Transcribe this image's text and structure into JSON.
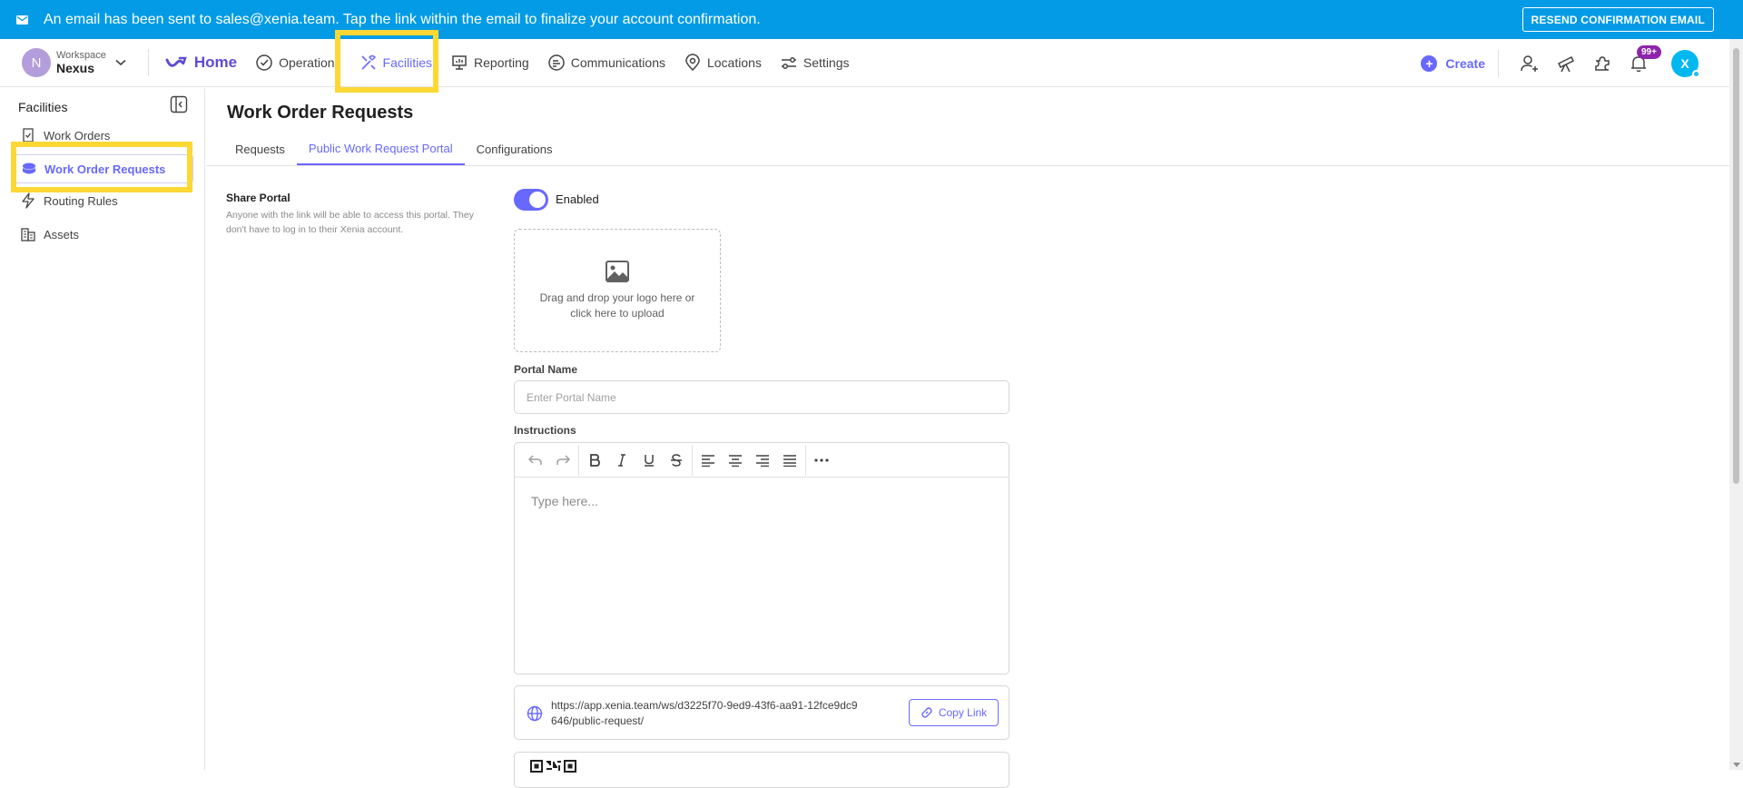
{
  "banner": {
    "message": "An email has been sent to sales@xenia.team. Tap the link within the email to finalize your account confirmation.",
    "resend_label": "RESEND CONFIRMATION EMAIL"
  },
  "workspace": {
    "initial": "N",
    "label": "Workspace",
    "name": "Nexus"
  },
  "nav": {
    "home": "Home",
    "operations": "Operations",
    "facilities": "Facilities",
    "reporting": "Reporting",
    "communications": "Communications",
    "locations": "Locations",
    "settings": "Settings"
  },
  "header_right": {
    "create_label": "Create",
    "notification_badge": "99+",
    "user_initial": "X"
  },
  "sidebar": {
    "title": "Facilities",
    "items": [
      {
        "label": "Work Orders"
      },
      {
        "label": "Work Order Requests"
      },
      {
        "label": "Routing Rules"
      },
      {
        "label": "Assets"
      }
    ]
  },
  "main": {
    "title": "Work Order Requests",
    "tabs": [
      {
        "label": "Requests"
      },
      {
        "label": "Public Work Request Portal"
      },
      {
        "label": "Configurations"
      }
    ],
    "share": {
      "title": "Share Portal",
      "description": "Anyone with the link will be able to access this portal. They don't have to log in to their Xenia account.",
      "toggle_label": "Enabled"
    },
    "upload_text": "Drag and drop your logo here or click here to upload",
    "portal_name_label": "Portal Name",
    "portal_name_placeholder": "Enter Portal Name",
    "instructions_label": "Instructions",
    "editor_placeholder": "Type here...",
    "link_url": "https://app.xenia.team/ws/d3225f70-9ed9-43f6-aa91-12fce9dc9646/public-request/",
    "copy_label": "Copy Link"
  },
  "colors": {
    "accent": "#6868fe",
    "banner": "#039be5",
    "highlight": "#fdd835"
  }
}
